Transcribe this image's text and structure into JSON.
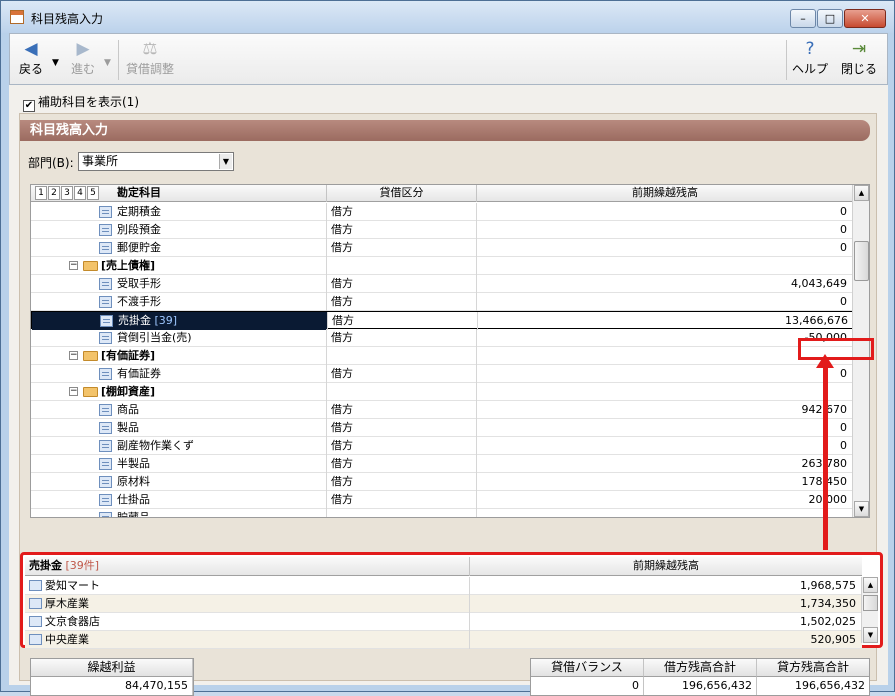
{
  "window": {
    "title": "科目残高入力",
    "minimize": "–",
    "maximize": "□",
    "close": "✕"
  },
  "toolbar": {
    "back": "戻る",
    "forward": "進む",
    "adjust": "貸借調整",
    "help": "ヘルプ",
    "close": "閉じる"
  },
  "options": {
    "show_sub_accounts": "補助科目を表示(1)",
    "show_sub_accounts_checked": true
  },
  "panel": {
    "title": "科目残高入力",
    "dept_label": "部門(B):",
    "dept_value": "事業所"
  },
  "grid": {
    "levels": [
      "1",
      "2",
      "3",
      "4",
      "5"
    ],
    "col_account": "勘定科目",
    "col_side": "貸借区分",
    "col_balance": "前期繰越残高",
    "rows": [
      {
        "name": "定期積金",
        "count": "",
        "side": "借方",
        "balance": "0",
        "type": "leaf"
      },
      {
        "name": "別段預金",
        "count": "",
        "side": "借方",
        "balance": "0",
        "type": "leaf"
      },
      {
        "name": "郵便貯金",
        "count": "",
        "side": "借方",
        "balance": "0",
        "type": "leaf"
      },
      {
        "name": "[売上債権]",
        "count": "",
        "side": "",
        "balance": "",
        "type": "group"
      },
      {
        "name": "受取手形",
        "count": "",
        "side": "借方",
        "balance": "4,043,649",
        "type": "leaf"
      },
      {
        "name": "不渡手形",
        "count": "",
        "side": "借方",
        "balance": "0",
        "type": "leaf"
      },
      {
        "name": "売掛金",
        "count": "[39]",
        "side": "借方",
        "balance": "13,466,676",
        "type": "leaf-selected"
      },
      {
        "name": "貸倒引当金(売)",
        "count": "",
        "side": "借方",
        "balance": "-50,000",
        "type": "leaf"
      },
      {
        "name": "[有価証券]",
        "count": "",
        "side": "",
        "balance": "",
        "type": "group"
      },
      {
        "name": "有価証券",
        "count": "",
        "side": "借方",
        "balance": "0",
        "type": "leaf"
      },
      {
        "name": "[棚卸資産]",
        "count": "",
        "side": "",
        "balance": "",
        "type": "group"
      },
      {
        "name": "商品",
        "count": "",
        "side": "借方",
        "balance": "942,670",
        "type": "leaf"
      },
      {
        "name": "製品",
        "count": "",
        "side": "借方",
        "balance": "0",
        "type": "leaf"
      },
      {
        "name": "副産物作業くず",
        "count": "",
        "side": "借方",
        "balance": "0",
        "type": "leaf"
      },
      {
        "name": "半製品",
        "count": "",
        "side": "借方",
        "balance": "263,780",
        "type": "leaf"
      },
      {
        "name": "原材料",
        "count": "",
        "side": "借方",
        "balance": "178,450",
        "type": "leaf"
      },
      {
        "name": "仕掛品",
        "count": "",
        "side": "借方",
        "balance": "20,000",
        "type": "leaf"
      },
      {
        "name": "貯蔵品",
        "count": "",
        "side": "",
        "balance": "",
        "type": "leaf"
      }
    ]
  },
  "sub": {
    "title": "売掛金",
    "count": "[39件]",
    "col_balance": "前期繰越残高",
    "rows": [
      {
        "name": "愛知マート",
        "balance": "1,968,575"
      },
      {
        "name": "厚木産業",
        "balance": "1,734,350"
      },
      {
        "name": "文京食器店",
        "balance": "1,502,025"
      },
      {
        "name": "中央産業",
        "balance": "520,905"
      }
    ]
  },
  "footer": {
    "profit_label": "繰越利益",
    "profit_value": "84,470,155",
    "balance_label": "貸借バランス",
    "balance_value": "0",
    "debit_label": "借方残高合計",
    "debit_value": "196,656,432",
    "credit_label": "貸方残高合計",
    "credit_value": "196,656,432"
  },
  "colors": {
    "highlight": "#e21b1b",
    "panel_header": "#a87468",
    "selected_row": "#0a1a33"
  }
}
